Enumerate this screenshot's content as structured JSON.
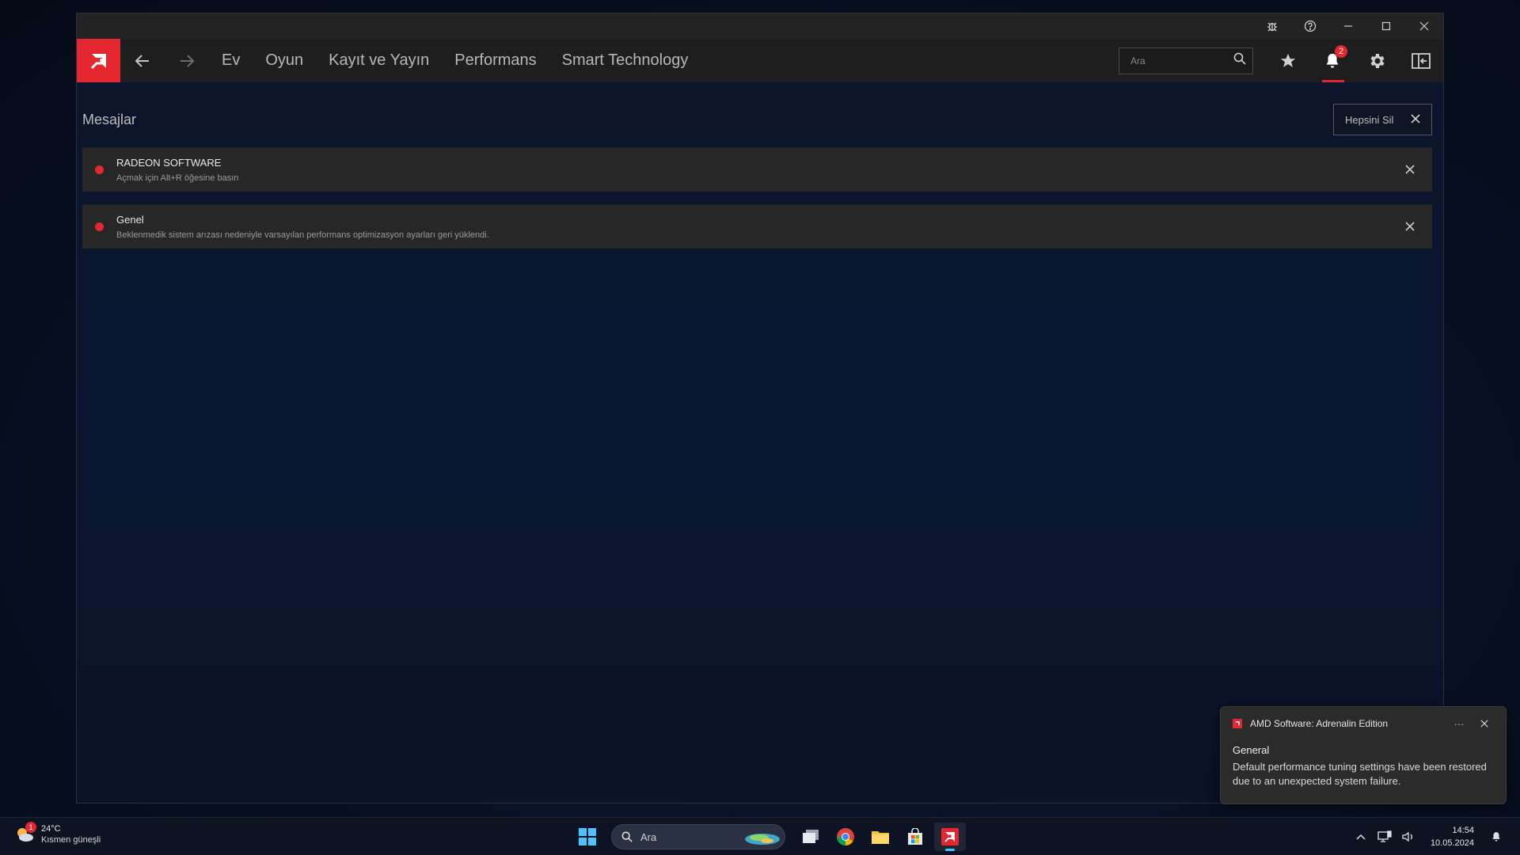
{
  "window": {
    "titlebar_icons": [
      "bug-report-icon",
      "help-icon",
      "minimize-icon",
      "maximize-icon",
      "close-icon"
    ]
  },
  "nav": {
    "links": [
      "Ev",
      "Oyun",
      "Kayıt ve Yayın",
      "Performans",
      "Smart Technology"
    ],
    "search_placeholder": "Ara",
    "notification_count": "2"
  },
  "messages": {
    "title": "Mesajlar",
    "clear_all_label": "Hepsini Sil",
    "items": [
      {
        "name": "RADEON SOFTWARE",
        "description": "Açmak için Alt+R öğesine basın"
      },
      {
        "name": "Genel",
        "description": "Beklenmedik sistem arızası nedeniyle varsayılan performans optimizasyon ayarları geri yüklendi."
      }
    ]
  },
  "toast": {
    "app_name": "AMD Software: Adrenalin Edition",
    "more": "···",
    "title": "General",
    "body": "Default performance tuning settings have been restored due to an unexpected system failure."
  },
  "taskbar": {
    "weather_badge": "1",
    "weather_temp": "24°C",
    "weather_desc": "Kısmen güneşli",
    "search_label": "Ara",
    "time": "14:54",
    "date": "10.05.2024"
  },
  "colors": {
    "accent": "#e4262f",
    "navbar": "#1e1e1e",
    "card": "#272727"
  }
}
